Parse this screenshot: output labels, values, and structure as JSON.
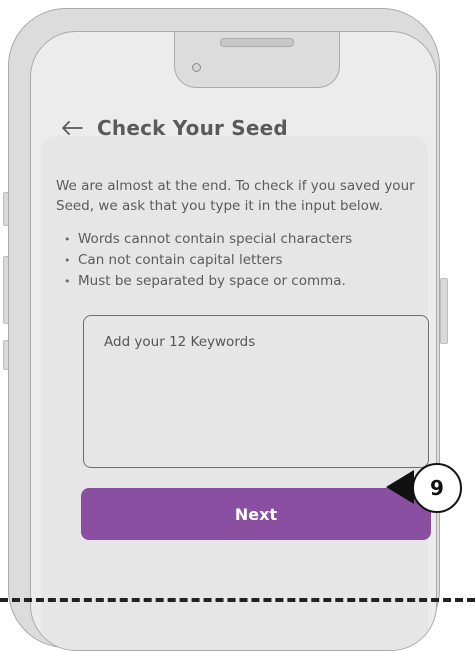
{
  "header": {
    "back_icon": "arrow-left-icon",
    "title": "Check Your Seed"
  },
  "content": {
    "intro": "We are almost at the end. To check if you saved your Seed, we ask that you type it in the input below.",
    "rules": [
      "Words cannot contain special characters",
      "Can not contain capital letters",
      "Must be separated by space or comma."
    ]
  },
  "keywords_input": {
    "placeholder": "Add your 12 Keywords",
    "value": ""
  },
  "next_button": {
    "label": "Next",
    "color": "#8a4fa1"
  },
  "callout": {
    "number": "9"
  }
}
